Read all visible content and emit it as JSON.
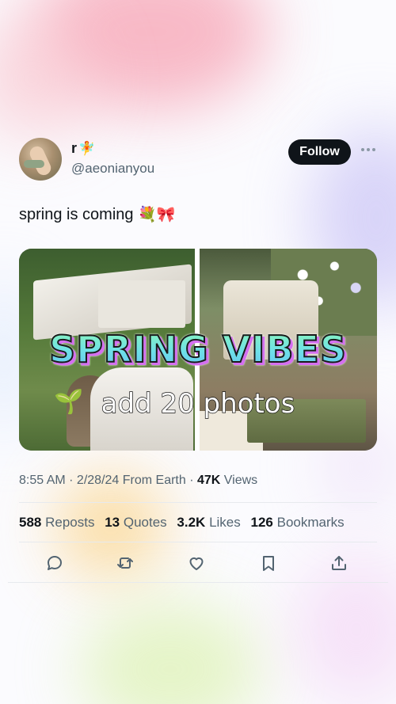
{
  "author": {
    "display_name": "r",
    "name_emoji": "🧚",
    "handle": "@aeonianyou",
    "follow_label": "Follow"
  },
  "tweet": {
    "text": "spring is coming",
    "emojis": "💐🎀"
  },
  "media": {
    "overlay_title": "SPRING VIBES",
    "overlay_subtitle": "add 20 photos",
    "sprout_emoji": "🌱"
  },
  "meta": {
    "timestamp": "8:55 AM · 2/28/24 From Earth · ",
    "views_count": "47K",
    "views_label": " Views"
  },
  "stats": [
    {
      "count": "588",
      "label": "Reposts"
    },
    {
      "count": "13",
      "label": "Quotes"
    },
    {
      "count": "3.2K",
      "label": "Likes"
    },
    {
      "count": "126",
      "label": "Bookmarks"
    }
  ],
  "colors": {
    "follow_bg": "#0f1419",
    "text_primary": "#0f1419",
    "text_secondary": "#536471"
  },
  "actions": [
    "reply-icon",
    "repost-icon",
    "like-icon",
    "bookmark-icon",
    "share-icon"
  ]
}
